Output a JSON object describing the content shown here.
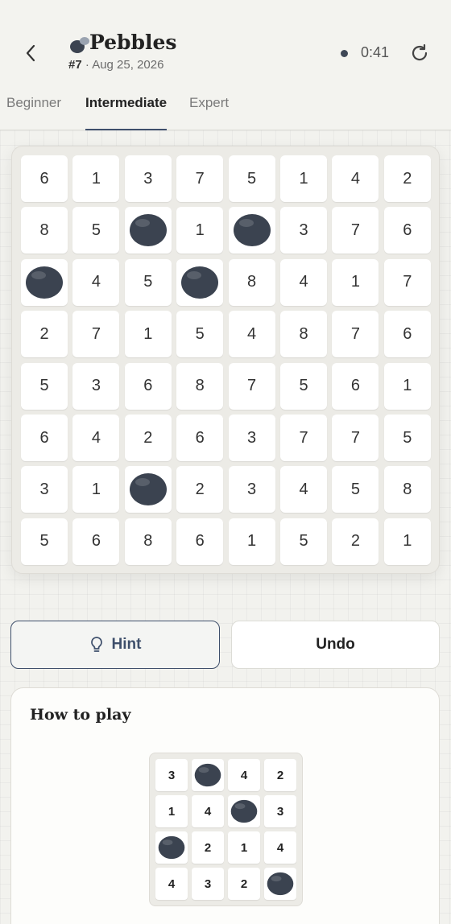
{
  "header": {
    "title": "Pebbles",
    "puzzle_number": "#7",
    "separator": "·",
    "date": "Aug 25, 2026",
    "timer": "0:41",
    "icons": {
      "back": "chevron-left-icon",
      "logo": "pebble-logo-icon",
      "status": "status-dot-icon",
      "refresh": "refresh-icon"
    }
  },
  "tabs": [
    {
      "label": "Beginner",
      "active": false
    },
    {
      "label": "Intermediate",
      "active": true
    },
    {
      "label": "Expert",
      "active": false
    }
  ],
  "board": {
    "size": 8,
    "cells": [
      [
        "6",
        "1",
        "3",
        "7",
        "5",
        "1",
        "4",
        "2"
      ],
      [
        "8",
        "5",
        "●",
        "1",
        "●",
        "3",
        "7",
        "6"
      ],
      [
        "●",
        "4",
        "5",
        "●",
        "8",
        "4",
        "1",
        "7"
      ],
      [
        "2",
        "7",
        "1",
        "5",
        "4",
        "8",
        "7",
        "6"
      ],
      [
        "5",
        "3",
        "6",
        "8",
        "7",
        "5",
        "6",
        "1"
      ],
      [
        "6",
        "4",
        "2",
        "6",
        "3",
        "7",
        "7",
        "5"
      ],
      [
        "3",
        "1",
        "●",
        "2",
        "3",
        "4",
        "5",
        "8"
      ],
      [
        "5",
        "6",
        "8",
        "6",
        "1",
        "5",
        "2",
        "1"
      ]
    ],
    "stone_symbol": "●",
    "stone_color": "#3b4350"
  },
  "actions": {
    "hint_label": "Hint",
    "undo_label": "Undo",
    "hint_icon": "lightbulb-icon"
  },
  "how_to_play": {
    "title": "How to play",
    "example": [
      [
        "3",
        "●",
        "4",
        "2"
      ],
      [
        "1",
        "4",
        "●",
        "3"
      ],
      [
        "●",
        "2",
        "1",
        "4"
      ],
      [
        "4",
        "3",
        "2",
        "●"
      ]
    ]
  },
  "colors": {
    "accent": "#3e4f6b",
    "background": "#f2f2ee",
    "board": "#ecebe6"
  }
}
